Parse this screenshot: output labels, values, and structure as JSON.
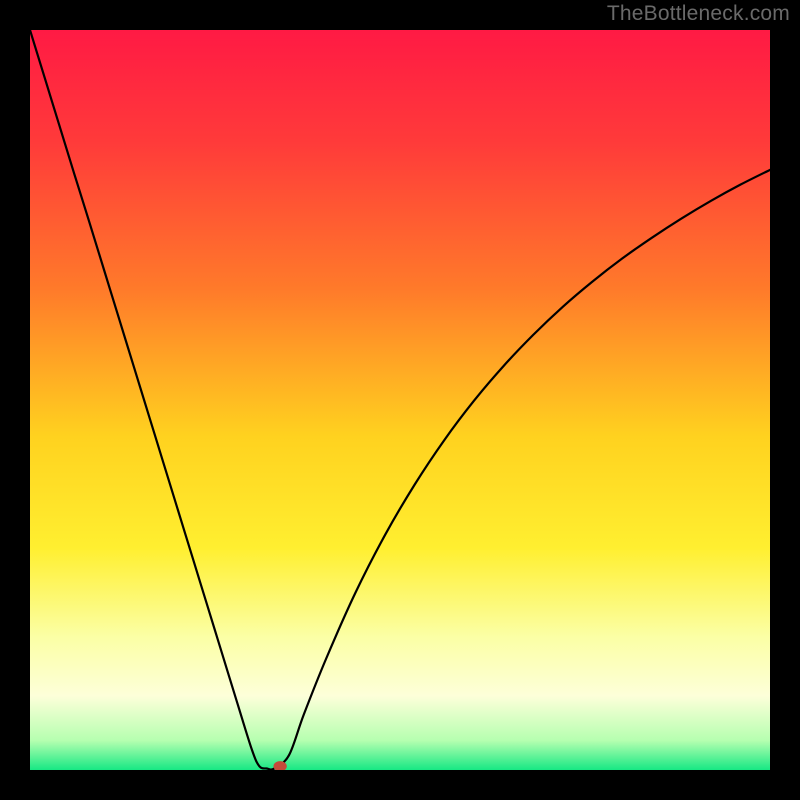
{
  "watermark": "TheBottleneck.com",
  "chart_data": {
    "type": "line",
    "title": "",
    "xlabel": "",
    "ylabel": "",
    "xlim": [
      0,
      100
    ],
    "ylim": [
      0,
      100
    ],
    "grid": false,
    "legend": false,
    "background_gradient_stops": [
      {
        "t": 0.0,
        "color": "#ff1a44"
      },
      {
        "t": 0.15,
        "color": "#ff3a3a"
      },
      {
        "t": 0.35,
        "color": "#ff7a2a"
      },
      {
        "t": 0.55,
        "color": "#ffd21f"
      },
      {
        "t": 0.7,
        "color": "#ffef30"
      },
      {
        "t": 0.82,
        "color": "#fbffa5"
      },
      {
        "t": 0.9,
        "color": "#fdffd9"
      },
      {
        "t": 0.96,
        "color": "#b6ffb0"
      },
      {
        "t": 1.0,
        "color": "#17e884"
      }
    ],
    "series": [
      {
        "name": "bottleneck-curve",
        "color": "#000000",
        "x": [
          0,
          2,
          4,
          6,
          8,
          10,
          12,
          14,
          16,
          18,
          20,
          22,
          24,
          26,
          28,
          30,
          31,
          32,
          33,
          35,
          37,
          40,
          44,
          48,
          52,
          56,
          60,
          64,
          68,
          72,
          76,
          80,
          84,
          88,
          92,
          96,
          100
        ],
        "y": [
          100,
          93.5,
          87.0,
          80.5,
          74.1,
          67.6,
          61.1,
          54.6,
          48.1,
          41.6,
          35.1,
          28.6,
          22.1,
          15.6,
          9.1,
          2.7,
          0.5,
          0.2,
          0.2,
          2.0,
          7.5,
          15.0,
          24.0,
          31.8,
          38.6,
          44.6,
          49.9,
          54.6,
          58.8,
          62.6,
          66.0,
          69.1,
          71.9,
          74.5,
          76.9,
          79.1,
          81.1
        ]
      }
    ],
    "marker": {
      "name": "target-point",
      "x": 33.8,
      "y": 0.5,
      "rx": 0.9,
      "ry": 0.7,
      "color": "#c44a3a"
    }
  }
}
